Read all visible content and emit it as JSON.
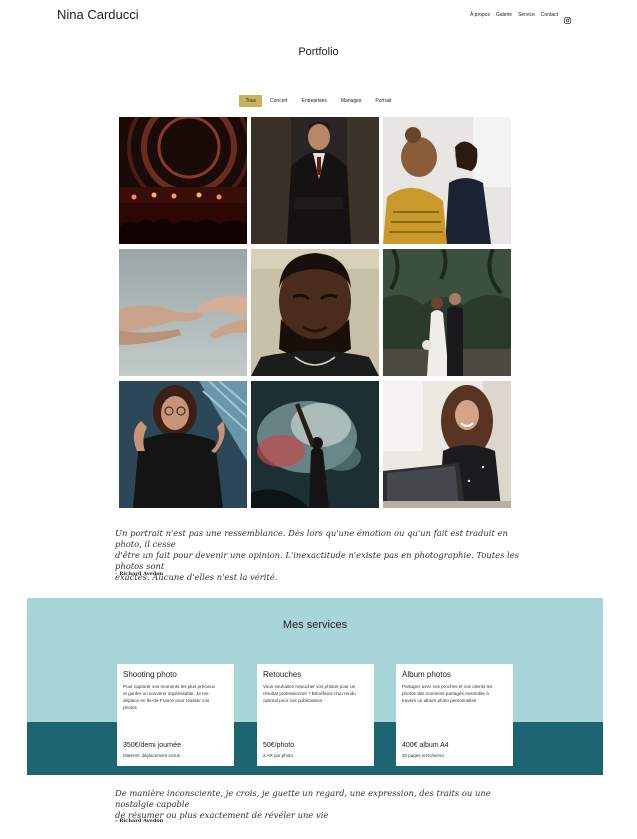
{
  "header": {
    "brand": "Nina Carducci",
    "nav": [
      {
        "label": "À propos"
      },
      {
        "label": "Galerie"
      },
      {
        "label": "Service"
      },
      {
        "label": "Contact"
      }
    ],
    "instagram_icon": "instagram-icon"
  },
  "portfolio": {
    "title": "Portfolio",
    "filters": [
      {
        "label": "Tous",
        "active": true
      },
      {
        "label": "Concert",
        "active": false
      },
      {
        "label": "Entreprises",
        "active": false
      },
      {
        "label": "Mariages",
        "active": false
      },
      {
        "label": "Portrait",
        "active": false
      }
    ],
    "photos": [
      {
        "name": "photo-concert-stage"
      },
      {
        "name": "photo-businessman-suit"
      },
      {
        "name": "photo-business-meeting"
      },
      {
        "name": "photo-hands-touching"
      },
      {
        "name": "photo-portrait-man-closed-eyes"
      },
      {
        "name": "photo-wedding-couple"
      },
      {
        "name": "photo-portrait-woman-glasses"
      },
      {
        "name": "photo-concert-crowd-smoke"
      },
      {
        "name": "photo-woman-laptop-laughing"
      }
    ]
  },
  "quote1": {
    "lines": [
      "Un portrait n'est pas une ressemblance. Dès lors qu'une émotion ou qu'un fait est traduit en photo, il cesse",
      "d'être un fait pour devenir une opinion. L'inexactitude n'existe pas en photographie. Toutes les photos sont",
      "exactes. Aucune d'elles n'est la vérité."
    ],
    "author": "– Richard Avedon"
  },
  "services": {
    "title": "Mes services",
    "cards": [
      {
        "title": "Shooting photo",
        "desc": [
          "Pour capturer vos moments les plus précieux",
          "et garder un souvenir impérissable. Je me",
          "déplace en Île-de-France pour réaliser vos",
          "photos"
        ],
        "price": "350€/demi journée",
        "note": "Matériel, déplacement inclus"
      },
      {
        "title": "Retouches",
        "desc": [
          "Vous souhaitez retoucher vos photos pour un",
          "résultat professionnel ? Bénéficiez d'un rendu",
          "optimal pour vos publications"
        ],
        "price": "50€/photo",
        "note": "2 AR par photo"
      },
      {
        "title": "Album photos",
        "desc": [
          "Partagez avec vos proches et vos clients les",
          "photos des moments partagés ensemble à",
          "travers un album photo personnalisé"
        ],
        "price": "400€ album A4",
        "note": "30 pages recto/verso"
      }
    ]
  },
  "quote2": {
    "lines": [
      "De manière inconsciente, je crois, je guette un regard, une expression, des traits ou une nostalgie capable",
      "de résumer ou plus exactement de révéler une vie"
    ],
    "author": "– Richard Avedon"
  },
  "colors": {
    "accent": "#c6b45d",
    "services_bg": "#a8d5d8",
    "services_band": "#1b6470"
  }
}
